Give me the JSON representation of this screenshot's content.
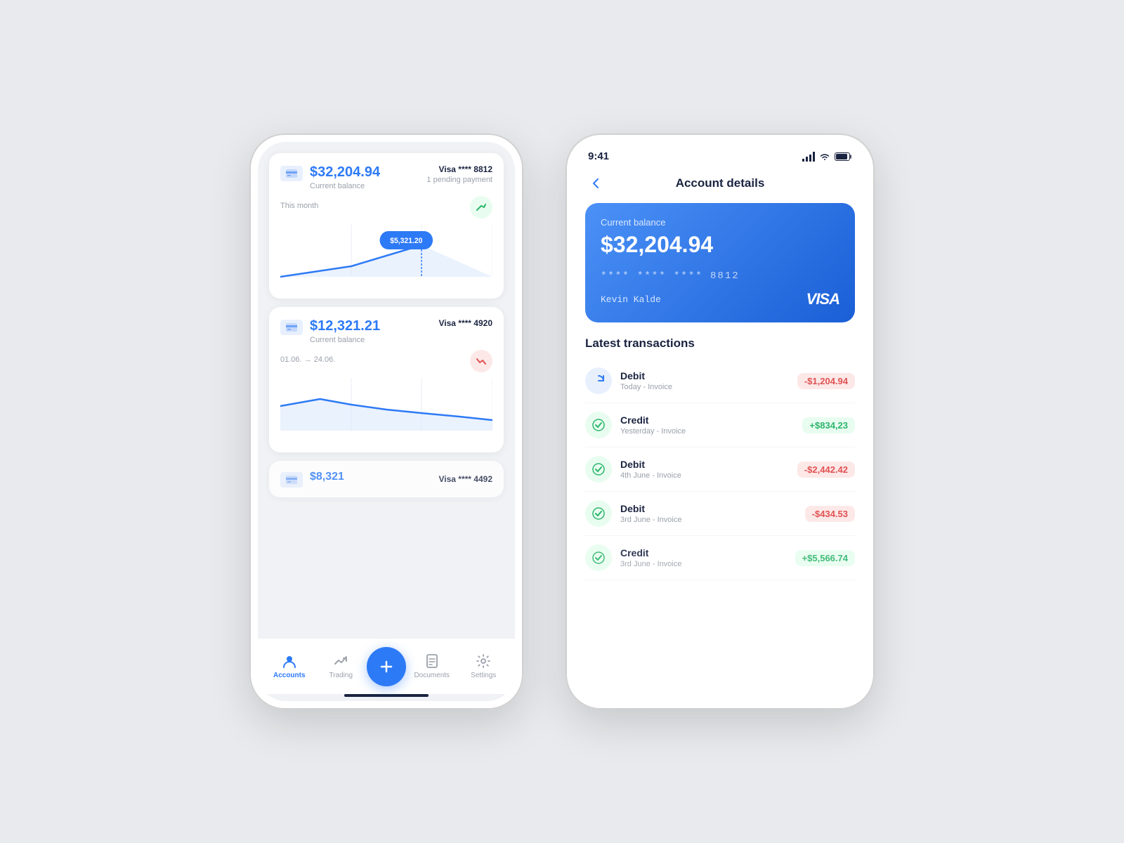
{
  "leftPhone": {
    "accounts": [
      {
        "balance": "$32,204.94",
        "balanceLabel": "Current balance",
        "visaLabel": "Visa **** 8812",
        "pendingLabel": "1 pending payment",
        "chartLabel": "This month",
        "trend": "up",
        "chartTooltip": "$5,321.20"
      },
      {
        "balance": "$12,321.21",
        "balanceLabel": "Current balance",
        "visaLabel": "Visa **** 4920",
        "pendingLabel": "",
        "chartLabel": "01.06. → 24.06.",
        "trend": "down"
      }
    ],
    "partialCard": {
      "balance": "$8,321",
      "visaLabel": "Visa **** 4492"
    },
    "nav": {
      "items": [
        {
          "label": "Accounts",
          "active": true
        },
        {
          "label": "Trading",
          "active": false
        },
        {
          "label": "",
          "isFab": true
        },
        {
          "label": "Documents",
          "active": false
        },
        {
          "label": "Settings",
          "active": false
        }
      ],
      "fabLabel": "+"
    }
  },
  "rightPhone": {
    "statusBar": {
      "time": "9:41"
    },
    "header": {
      "backLabel": "←",
      "title": "Account details"
    },
    "card": {
      "balanceLabel": "Current balance",
      "balance": "$32,204.94",
      "cardNumber": "****  ****  ****  8812",
      "holderName": "Kevin Kalde",
      "brand": "VISA"
    },
    "transactionsTitle": "Latest transactions",
    "transactions": [
      {
        "type": "Debit",
        "date": "Today - Invoice",
        "amount": "-$1,204.94",
        "isPositive": false,
        "iconType": "blue"
      },
      {
        "type": "Credit",
        "date": "Yesterday - Invoice",
        "amount": "+$834,23",
        "isPositive": true,
        "iconType": "green"
      },
      {
        "type": "Debit",
        "date": "4th June - Invoice",
        "amount": "-$2,442.42",
        "isPositive": false,
        "iconType": "green"
      },
      {
        "type": "Debit",
        "date": "3rd June - Invoice",
        "amount": "-$434.53",
        "isPositive": false,
        "iconType": "green"
      },
      {
        "type": "Credit",
        "date": "3rd June - Invoice",
        "amount": "+$5,566.74",
        "isPositive": true,
        "iconType": "green"
      }
    ]
  }
}
